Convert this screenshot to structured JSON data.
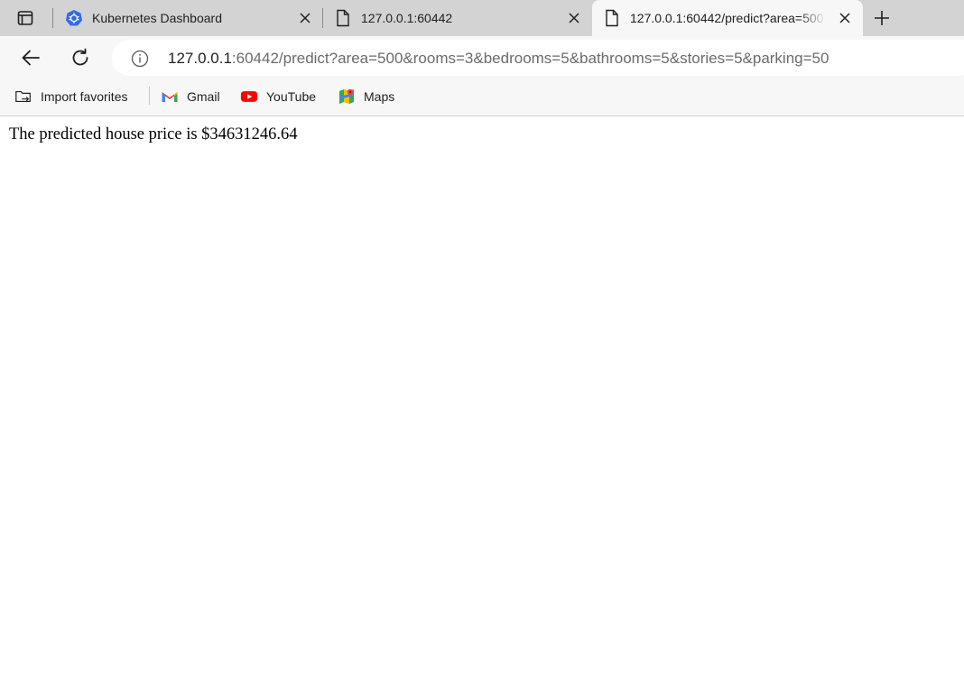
{
  "browser": {
    "tabs": [
      {
        "title": "Kubernetes Dashboard",
        "icon": "kubernetes-icon",
        "active": false
      },
      {
        "title": "127.0.0.1:60442",
        "icon": "page-icon",
        "active": false
      },
      {
        "title": "127.0.0.1:60442/predict?area=500",
        "icon": "page-icon",
        "active": true
      }
    ],
    "address": {
      "host": "127.0.0.1",
      "rest": ":60442/predict?area=500&rooms=3&bedrooms=5&bathrooms=5&stories=5&parking=50"
    },
    "bookmarks": [
      {
        "label": "Import favorites",
        "icon": "import-favorites-icon"
      },
      {
        "label": "Gmail",
        "icon": "gmail-icon"
      },
      {
        "label": "YouTube",
        "icon": "youtube-icon"
      },
      {
        "label": "Maps",
        "icon": "maps-icon"
      }
    ],
    "colors": {
      "tab_strip": "#d3d3d3",
      "toolbar": "#f7f7f7",
      "kubernetes": "#326ce5",
      "youtube": "#ff0000"
    }
  },
  "page": {
    "text": "The predicted house price is $34631246.64"
  }
}
